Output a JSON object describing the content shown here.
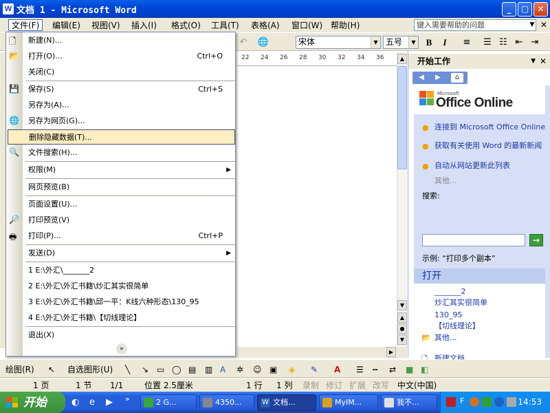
{
  "window": {
    "title": "文档 1 - Microsoft Word",
    "icon": "W",
    "min": "_",
    "max": "▢",
    "close": "✕"
  },
  "menubar": {
    "items": [
      "文件(F)",
      "编辑(E)",
      "视图(V)",
      "插入(I)",
      "格式(O)",
      "工具(T)",
      "表格(A)",
      "窗口(W)",
      "帮助(H)"
    ],
    "help_placeholder": "键入需要帮助的问题",
    "close_doc": "✕"
  },
  "toolbar": {
    "font": "宋体",
    "size": "五号",
    "bold": "B",
    "italic": "I"
  },
  "ruler": {
    "ticks": [
      "22",
      "24",
      "26",
      "28",
      "30",
      "32",
      "34",
      "36"
    ]
  },
  "file_menu": {
    "items": [
      {
        "label": "新建(N)...",
        "shortcut": "",
        "icon": "new-document-icon"
      },
      {
        "label": "打开(O)...",
        "shortcut": "Ctrl+O",
        "icon": "open-folder-icon"
      },
      {
        "label": "关闭(C)",
        "shortcut": ""
      },
      {
        "label": "保存(S)",
        "shortcut": "Ctrl+S",
        "icon": "save-icon"
      },
      {
        "label": "另存为(A)...",
        "shortcut": ""
      },
      {
        "label": "另存为网页(G)...",
        "shortcut": "",
        "icon": "save-web-icon"
      },
      {
        "label": "删除隐藏数据(T)...",
        "shortcut": "",
        "highlighted": true
      },
      {
        "label": "文件搜索(H)...",
        "shortcut": "",
        "icon": "file-search-icon"
      },
      {
        "label": "权限(M)",
        "shortcut": "",
        "submenu": true
      },
      {
        "label": "网页预览(B)",
        "shortcut": ""
      },
      {
        "label": "页面设置(U)...",
        "shortcut": ""
      },
      {
        "label": "打印预览(V)",
        "shortcut": "",
        "icon": "print-preview-icon"
      },
      {
        "label": "打印(P)...",
        "shortcut": "Ctrl+P",
        "icon": "print-icon"
      },
      {
        "label": "发送(D)",
        "shortcut": "",
        "submenu": true
      },
      {
        "label": "1 E:\\外汇\\_______2",
        "shortcut": ""
      },
      {
        "label": "2 E:\\外汇\\外汇书籍\\炒汇其实很简单",
        "shortcut": ""
      },
      {
        "label": "3 E:\\外汇\\外汇书籍\\邱一平：K线六种形态\\130_95",
        "shortcut": ""
      },
      {
        "label": "4 E:\\外汇\\外汇书籍\\【切线理论】",
        "shortcut": ""
      },
      {
        "label": "退出(X)",
        "shortcut": ""
      }
    ],
    "more": "»"
  },
  "task_pane": {
    "title": "开始工作",
    "logo_small": "Microsoft",
    "logo": "Office Online",
    "links": [
      "连接到 Microsoft Office Online",
      "获取有关使用 Word 的最新新闻",
      "自动从网站更新此列表"
    ],
    "more": "其他...",
    "search_label": "搜索:",
    "example": "示例:  “打印多个副本”",
    "open_title": "打开",
    "recent": [
      "_______2",
      "炒汇其实很简单",
      "130_95",
      "【切线理论】"
    ],
    "open_more": "其他...",
    "new_doc": "新建文档..."
  },
  "drawbar": {
    "draw": "绘图(R)",
    "autoshapes": "自选图形(U)"
  },
  "status": {
    "page": "1 页",
    "section": "1 节",
    "pages": "1/1",
    "position": "位置 2.5厘米",
    "line": "1 行",
    "col": "1 列",
    "rec": "录制",
    "trk": "修订",
    "ext": "扩展",
    "ovr": "改写",
    "lang": "中文(中国)"
  },
  "taskbar": {
    "start": "开始",
    "tasks": [
      "2 G...",
      "4350...",
      "文档...",
      "MyIM...",
      "我不..."
    ],
    "tray_letter": "F",
    "clock": "14:53"
  }
}
